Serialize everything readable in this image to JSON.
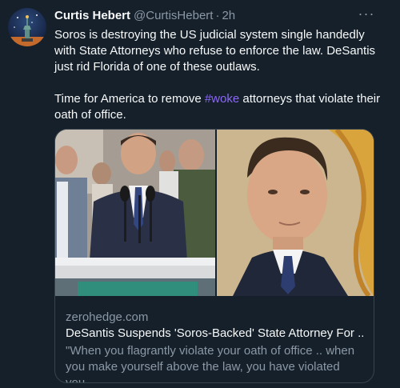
{
  "author": {
    "name": "Curtis Hebert",
    "handle": "@CurtisHebert",
    "separator": "·",
    "time": "2h"
  },
  "more_label": "···",
  "tweet": {
    "line1": "Soros is destroying the US judicial system single handedly with State Attorneys who refuse to enforce the law. DeSantis just rid Florida of one of these outlaws.",
    "line2_before": "Time for America to remove ",
    "hashtag": "#woke",
    "line2_after": " attorneys that violate their oath of office."
  },
  "card": {
    "domain": "zerohedge.com",
    "title": "DeSantis Suspends 'Soros-Backed' State Attorney For ...",
    "description": "\"When you flagrantly violate your oath of office .. when you make yourself above the law, you have violated you..."
  },
  "colors": {
    "background": "#15202b",
    "text": "#f7f9f9",
    "secondary": "#8b98a5",
    "hashtag": "#8b67f6",
    "border": "#38444d"
  }
}
